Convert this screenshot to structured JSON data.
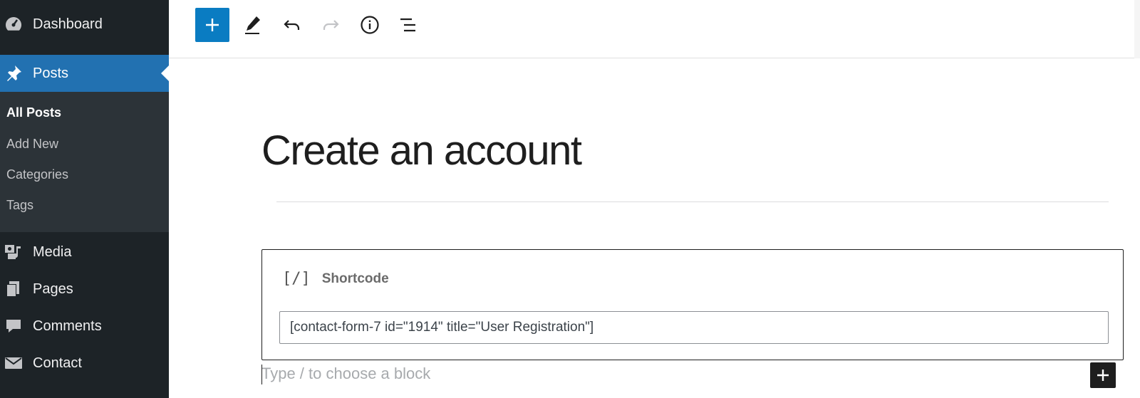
{
  "sidebar": {
    "items": [
      {
        "label": "Dashboard",
        "icon": "dashboard-icon"
      },
      {
        "label": "Posts",
        "icon": "pin-icon",
        "active": true
      },
      {
        "label": "Media",
        "icon": "media-icon"
      },
      {
        "label": "Pages",
        "icon": "pages-icon"
      },
      {
        "label": "Comments",
        "icon": "comment-icon"
      },
      {
        "label": "Contact",
        "icon": "mail-icon"
      }
    ],
    "submenu": [
      {
        "label": "All Posts",
        "current": true
      },
      {
        "label": "Add New"
      },
      {
        "label": "Categories"
      },
      {
        "label": "Tags"
      }
    ]
  },
  "toolbar": {
    "buttons": [
      "add-block-icon",
      "pencil-icon",
      "undo-icon",
      "redo-icon",
      "info-icon",
      "list-view-icon"
    ]
  },
  "editor": {
    "title": "Create an account",
    "block": {
      "icon_text": "[/]",
      "title": "Shortcode",
      "value": "[contact-form-7 id=\"1914\" title=\"User Registration\"]"
    },
    "appender_placeholder": "Type / to choose a block"
  },
  "colors": {
    "sidebar_bg": "#1d2327",
    "submenu_bg": "#2c3338",
    "active_bg": "#2271b1",
    "primary_button": "#0a7cc2"
  }
}
